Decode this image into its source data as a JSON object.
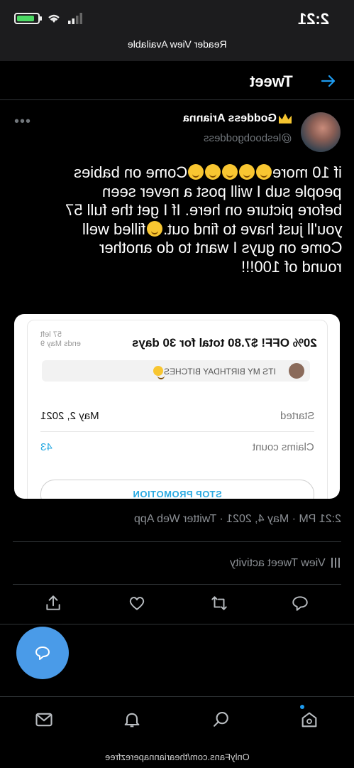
{
  "status_bar": {
    "time": "2:21"
  },
  "reader_bar": {
    "text": "Reader View Available"
  },
  "header": {
    "title": "Tweet"
  },
  "author": {
    "name": "Goddess Arianna",
    "handle": "@lesboobgoddess"
  },
  "tweet": {
    "lines": [
      "Come on babies",
      "if 10 more",
      "people sub I will post a never seen",
      "before picture on here. If I get the full 57",
      "filled well",
      "you'll just have to find out.",
      "Come on guys I want to do another",
      "round of 100!!!"
    ]
  },
  "card": {
    "offer_title": "20% OFF! $7.80 total for 30 days",
    "left_count": "57 left",
    "ends": "ends May 9",
    "birthday_text": "ITS MY BIRTHDAY BITCHES",
    "started_label": "Started",
    "started_value": "May 2, 2021",
    "claims_label": "Claims count",
    "claims_value": "43",
    "stop_button": "STOP PROMOTION"
  },
  "meta": {
    "text": "2:21 PM · May 4, 2021 · Twitter Web App"
  },
  "activity": {
    "label": "View Tweet activity"
  },
  "footer": {
    "url": "OnlyFans.com/theariannaperezfree"
  },
  "icons": {
    "back": "arrow-right-icon",
    "more": "more-dots-icon",
    "share": "share-icon",
    "like": "heart-icon",
    "retweet": "retweet-icon",
    "reply": "reply-icon",
    "compose": "compose-reply-icon",
    "home": "home-icon",
    "search": "search-icon",
    "notifications": "bell-icon",
    "messages": "mail-icon"
  },
  "colors": {
    "accent": "#1d9bf0",
    "fab": "#4a9be8",
    "background": "#000000",
    "battery": "#4cd964"
  }
}
